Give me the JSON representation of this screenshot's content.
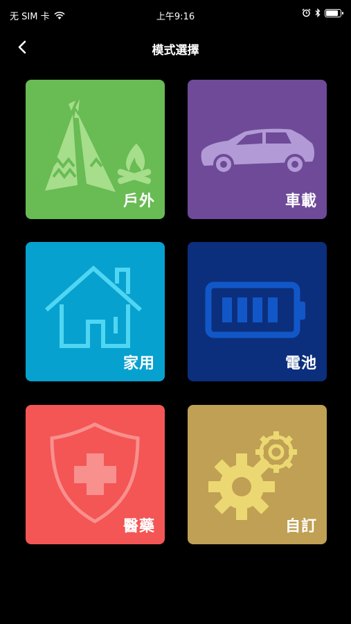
{
  "status_bar": {
    "carrier": "无 SIM 卡",
    "time": "上午9:16",
    "icons": [
      "wifi-icon",
      "alarm-icon",
      "bluetooth-icon",
      "battery-icon"
    ],
    "battery_level": 0.85
  },
  "nav": {
    "title": "模式選擇",
    "back_icon": "chevron-left-icon"
  },
  "modes": [
    {
      "label": "戶外",
      "icon": "teepee-campfire-icon",
      "color": "#69bb54"
    },
    {
      "label": "車載",
      "icon": "car-icon",
      "color": "#6e4a98"
    },
    {
      "label": "家用",
      "icon": "house-icon",
      "color": "#07a1cf"
    },
    {
      "label": "電池",
      "icon": "battery-icon",
      "color": "#0b2f7d"
    },
    {
      "label": "醫藥",
      "icon": "medical-shield-icon",
      "color": "#f35654"
    },
    {
      "label": "自訂",
      "icon": "gears-icon",
      "color": "#c0a054"
    }
  ]
}
